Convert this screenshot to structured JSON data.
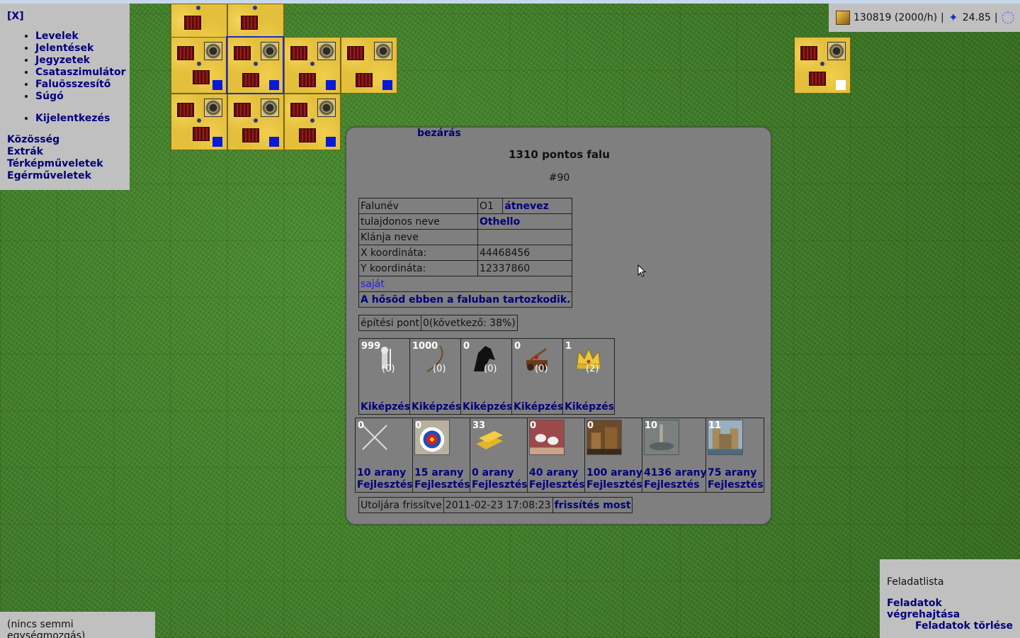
{
  "menu": {
    "close": "[X]",
    "items": [
      "Levelek",
      "Jelentések",
      "Jegyzetek",
      "Csataszimulátor",
      "Faluösszesítő",
      "Súgó"
    ],
    "logout": "Kijelentkezés",
    "sections": [
      "Közösség",
      "Extrák",
      "Térképműveletek",
      "Egérműveletek"
    ]
  },
  "status": {
    "gold": "130819 (2000/h)",
    "separator": "|",
    "points": "24.85",
    "separator2": "|"
  },
  "popup": {
    "close": "bezárás",
    "title": "1310 pontos falu",
    "village_id": "#90",
    "info": {
      "name_label": "Falunév",
      "name_value": "O1",
      "rename": "átnevez",
      "owner_label": "tulajdonos neve",
      "owner_value": "Othello",
      "clan_label": "Klánja neve",
      "clan_value": "",
      "x_label": "X koordináta:",
      "x_value": "44468456",
      "y_label": "Y koordináta:",
      "y_value": "12337860",
      "own": "saját",
      "hero": "A hősöd ebben a faluban tartozkodik."
    },
    "build": {
      "label": "építési pont",
      "value": "0(következő: 38%)"
    },
    "units": [
      {
        "count": "999",
        "queue": "(0)",
        "icon": "swordsman-icon",
        "action": "Kiképzés"
      },
      {
        "count": "1000",
        "queue": "(0)",
        "icon": "archer-icon",
        "action": "Kiképzés"
      },
      {
        "count": "0",
        "queue": "(0)",
        "icon": "horse-icon",
        "action": "Kiképzés"
      },
      {
        "count": "0",
        "queue": "(0)",
        "icon": "catapult-icon",
        "action": "Kiképzés"
      },
      {
        "count": "1",
        "queue": "(2)",
        "icon": "crown-icon",
        "action": "Kiképzés"
      }
    ],
    "upgrades": [
      {
        "level": "0",
        "cost": "10 arany",
        "action": "Fejlesztés",
        "icon": "swords-icon"
      },
      {
        "level": "0",
        "cost": "15 arany",
        "action": "Fejlesztés",
        "icon": "target-icon"
      },
      {
        "level": "33",
        "cost": "0 arany",
        "action": "Fejlesztés",
        "icon": "gold-bars-icon"
      },
      {
        "level": "0",
        "cost": "40 arany",
        "action": "Fejlesztés",
        "icon": "sheep-icon"
      },
      {
        "level": "0",
        "cost": "100 arany",
        "action": "Fejlesztés",
        "icon": "workshop-icon"
      },
      {
        "level": "10",
        "cost": "4136 arany",
        "action": "Fejlesztés",
        "icon": "market-icon"
      },
      {
        "level": "11",
        "cost": "75 arany",
        "action": "Fejlesztés",
        "icon": "castle-icon"
      }
    ],
    "refresh": {
      "label": "Utoljára frissítve",
      "value": "2011-02-23 17:08:23",
      "action": "frissítés most"
    }
  },
  "movements": "(nincs semmi egységmozgás)",
  "tasks": {
    "title": "Feladatlista",
    "execute": "Feladatok végrehajtása",
    "clear": "Feladatok törlése"
  },
  "colors": {
    "panel": "#c0c0c0",
    "popup": "#7f7f7f",
    "link": "#00007a",
    "own_flag": "#0a18d8"
  }
}
